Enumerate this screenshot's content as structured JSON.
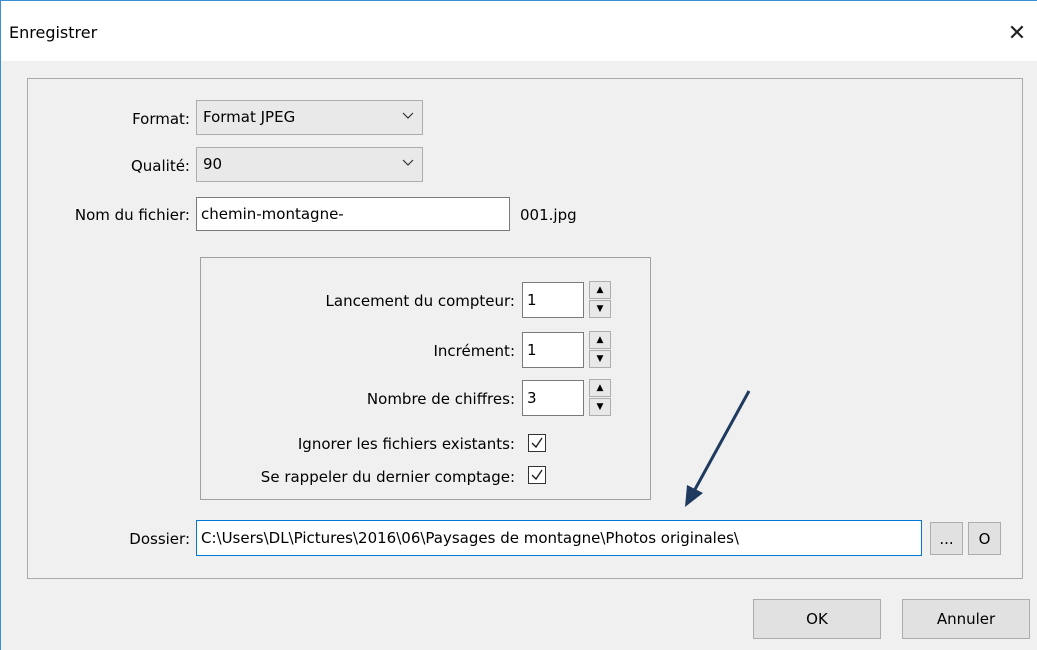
{
  "window": {
    "title": "Enregistrer",
    "close_glyph": "✕"
  },
  "form": {
    "format_label": "Format:",
    "format_value": "Format JPEG",
    "quality_label": "Qualité:",
    "quality_value": "90",
    "filename_label": "Nom du fichier:",
    "filename_value": "chemin-montagne-",
    "filename_suffix": "001.jpg"
  },
  "counter": {
    "start_label": "Lancement du compteur:",
    "start_value": "1",
    "increment_label": "Incrément:",
    "increment_value": "1",
    "digits_label": "Nombre de chiffres:",
    "digits_value": "3",
    "ignore_label": "Ignorer les fichiers existants:",
    "ignore_checked": true,
    "remember_label": "Se rappeler du dernier comptage:",
    "remember_checked": true,
    "spin_up_glyph": "▲",
    "spin_down_glyph": "▼"
  },
  "folder": {
    "label": "Dossier:",
    "value": "C:\\Users\\DL\\Pictures\\2016\\06\\Paysages de montagne\\Photos originales\\",
    "browse_label": "...",
    "open_label": "O"
  },
  "buttons": {
    "ok_label": "OK",
    "cancel_label": "Annuler"
  },
  "annotation": {
    "arrow_color": "#1f3a5f"
  },
  "icons": [
    "close-icon",
    "chevron-down-icon",
    "spin-up-icon",
    "spin-down-icon",
    "checkmark-icon",
    "annotation-arrow"
  ]
}
